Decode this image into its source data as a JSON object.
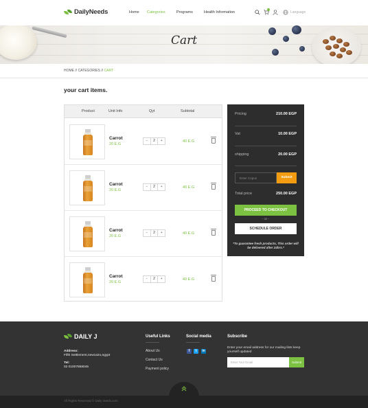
{
  "header": {
    "logo": "DailyNeeds",
    "nav": [
      "Home",
      "Categories",
      "Programs",
      "Health Information"
    ],
    "active_nav": "Categories",
    "language": "Language",
    "cart_count": "0"
  },
  "banner": {
    "title": "Cart"
  },
  "breadcrumb": {
    "home": "HOME",
    "sep1": " // ",
    "categories": "CATEGORIES",
    "sep2": " // ",
    "current": "CART"
  },
  "page_title": "your cart items.",
  "table": {
    "columns": [
      "Product",
      "Unit Info",
      "Qyt",
      "Subtotal"
    ],
    "rows": [
      {
        "name": "Carrot",
        "unit_price": "20 E.G",
        "qty": "2",
        "subtotal": "40 E.G"
      },
      {
        "name": "Carrot",
        "unit_price": "20 E.G",
        "qty": "2",
        "subtotal": "40 E.G"
      },
      {
        "name": "Carrot",
        "unit_price": "20 E.G",
        "qty": "2",
        "subtotal": "40 E.G"
      },
      {
        "name": "Carrot",
        "unit_price": "20 E.G",
        "qty": "2",
        "subtotal": "40 E.G"
      }
    ],
    "minus": "−",
    "plus": "+"
  },
  "summary": {
    "pricing_label": "Pricing",
    "pricing_value": "210.00 EGP",
    "vat_label": "Vat",
    "vat_value": "10.00 EGP",
    "shipping_label": "shipping",
    "shipping_value": "20.00 EGP",
    "coupon_placeholder": "Enter Copun",
    "coupon_button": "Submit",
    "total_label": "Total price",
    "total_value": "250.00 EGP",
    "checkout": "PROCEED TO CHECKOUT",
    "or": "- or -",
    "schedule": "SCHEDULE ORDER",
    "note": "*To guarantee fresh products, This order will be delivered after 24hrs.*"
  },
  "footer": {
    "logo": "DAILY J",
    "address_label": "Address:",
    "address": "Fifth Settlement,newcairo,egypt",
    "tel_label": "Tel:",
    "tel": "02 01007858045",
    "useful_title": "Useful Links",
    "links": [
      "About Us",
      "Contact Us",
      "Payment policy"
    ],
    "social_title": "Social  media",
    "subscribe_title": "Subscribe",
    "subscribe_text": "Enter your email address for our mailing lists keep yourself updated",
    "subscribe_placeholder": "Enter Your Email",
    "subscribe_button": "Submit",
    "copyright": "All Rights Reserved © Daily needs.com"
  },
  "colors": {
    "accent": "#7dc142",
    "orange": "#f39c12",
    "dark": "#2d2d2d"
  }
}
